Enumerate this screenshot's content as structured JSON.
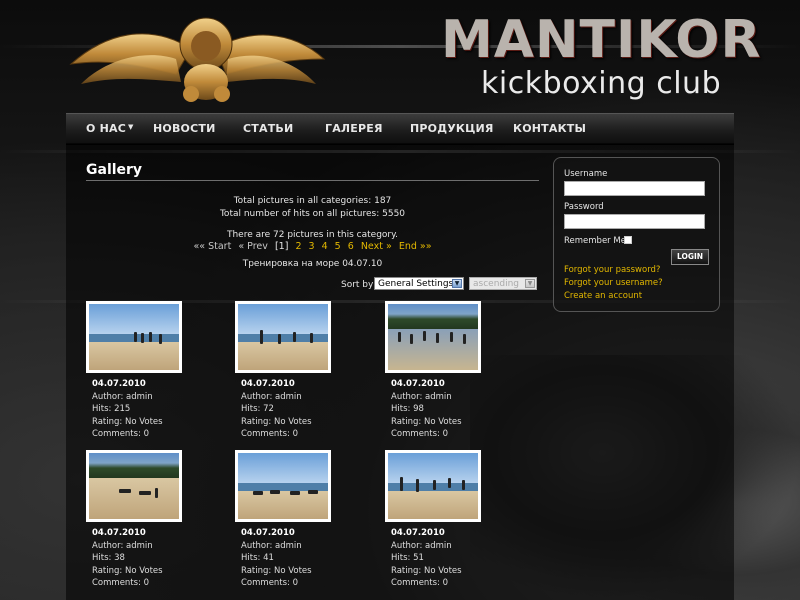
{
  "brand": {
    "title": "MANTIKOR",
    "subtitle": "kickboxing club",
    "accent_color": "#e2b700"
  },
  "nav": {
    "items": [
      {
        "label": "О НАС",
        "has_dropdown": true
      },
      {
        "label": "НОВОСТИ"
      },
      {
        "label": "СТАТЬИ"
      },
      {
        "label": "ГАЛЕРЕЯ"
      },
      {
        "label": "ПРОДУКЦИЯ"
      },
      {
        "label": "КОНТАКТЫ"
      }
    ]
  },
  "gallery": {
    "title": "Gallery",
    "total_pictures": "Total pictures in all categories: 187",
    "total_hits": "Total number of hits on all pictures: 5550",
    "category_count": "There are 72 pictures in this category.",
    "category_name": "Тренировка на море 04.07.10",
    "pagination": {
      "first": "«« Start",
      "prev": "« Prev",
      "current": "[1]",
      "pages": [
        "2",
        "3",
        "4",
        "5",
        "6"
      ],
      "next": "Next »",
      "last": "End »»"
    },
    "sort": {
      "label": "Sort by",
      "field_selected": "General Settings",
      "order_selected": "ascending"
    },
    "items": [
      {
        "date": "04.07.2010",
        "author": "Author: admin",
        "hits": "Hits: 215",
        "rating": "Rating: No Votes",
        "comments": "Comments: 0",
        "thumb_icon": "beach-photo-icon"
      },
      {
        "date": "04.07.2010",
        "author": "Author: admin",
        "hits": "Hits: 72",
        "rating": "Rating: No Votes",
        "comments": "Comments: 0",
        "thumb_icon": "beach-photo-icon"
      },
      {
        "date": "04.07.2010",
        "author": "Author: admin",
        "hits": "Hits: 98",
        "rating": "Rating: No Votes",
        "comments": "Comments: 0",
        "thumb_icon": "beach-photo-icon"
      },
      {
        "date": "04.07.2010",
        "author": "Author: admin",
        "hits": "Hits: 38",
        "rating": "Rating: No Votes",
        "comments": "Comments: 0",
        "thumb_icon": "beach-photo-icon"
      },
      {
        "date": "04.07.2010",
        "author": "Author: admin",
        "hits": "Hits: 41",
        "rating": "Rating: No Votes",
        "comments": "Comments: 0",
        "thumb_icon": "beach-photo-icon"
      },
      {
        "date": "04.07.2010",
        "author": "Author: admin",
        "hits": "Hits: 51",
        "rating": "Rating: No Votes",
        "comments": "Comments: 0",
        "thumb_icon": "beach-photo-icon"
      }
    ]
  },
  "login": {
    "username_label": "Username",
    "username_value": "",
    "password_label": "Password",
    "password_value": "",
    "remember_label": "Remember Me",
    "button_label": "LOGIN",
    "forgot_password": "Forgot your password?",
    "forgot_username": "Forgot your username?",
    "create_account": "Create an account"
  }
}
